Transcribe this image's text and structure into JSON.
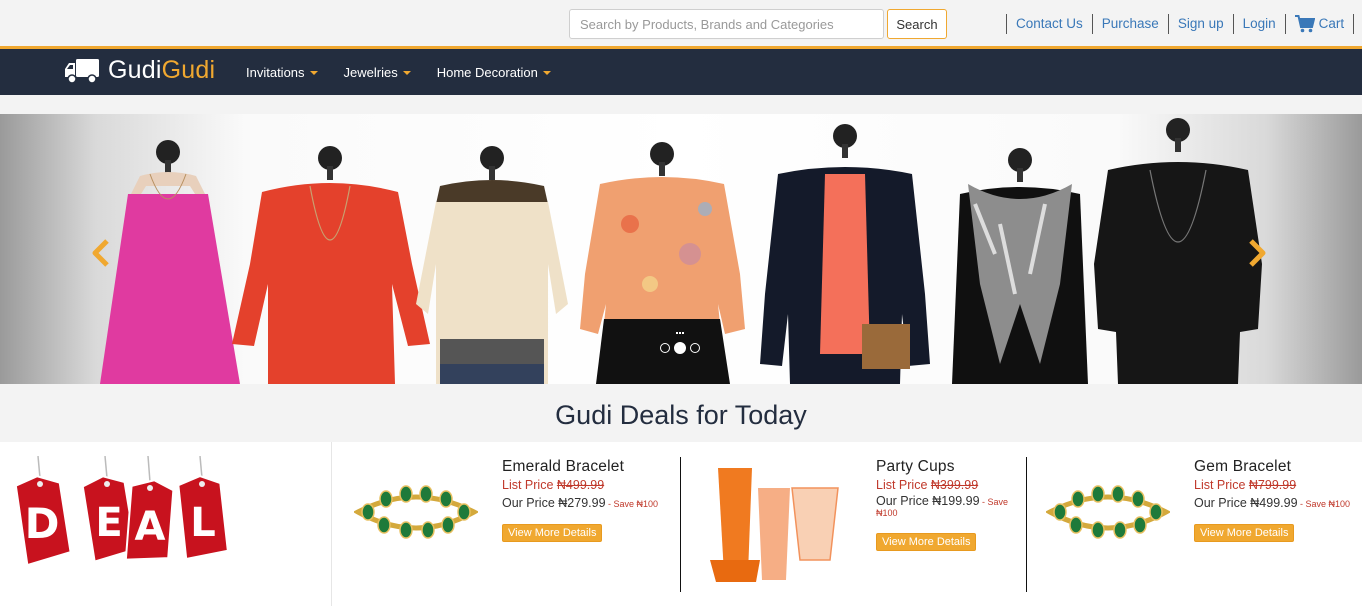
{
  "search": {
    "placeholder": "Search by Products, Brands and Categories",
    "value": "",
    "button_label": "Search"
  },
  "top_links": [
    {
      "label": "Contact Us"
    },
    {
      "label": "Purchase"
    },
    {
      "label": "Sign up"
    },
    {
      "label": "Login"
    },
    {
      "label": "Cart",
      "icon": "cart-icon"
    }
  ],
  "logo": {
    "part1": "Gudi",
    "part2": "Gudi",
    "icon": "truck-icon"
  },
  "nav": [
    {
      "label": "Invitations"
    },
    {
      "label": "Jewelries"
    },
    {
      "label": "Home Decoration"
    }
  ],
  "carousel": {
    "slides": 3,
    "active_slide": 2,
    "prev_icon": "chevron-left-icon",
    "next_icon": "chevron-right-icon"
  },
  "deals": {
    "title": "Gudi Deals for Today",
    "sign_letters": [
      "D",
      "E",
      "A",
      "L"
    ],
    "products": [
      {
        "name": "Emerald Bracelet",
        "list_label": "List Price ",
        "list_price": "₦499.99",
        "our_label": "Our Price ",
        "our_price": "₦279.99",
        "save": " - Save ₦100",
        "button": "View More Details"
      },
      {
        "name": "Party Cups",
        "list_label": "List Price ",
        "list_price": "₦399.99",
        "our_label": "Our Price ",
        "our_price": "₦199.99",
        "save": " - Save ₦100",
        "button": "View More Details"
      },
      {
        "name": "Gem Bracelet",
        "list_label": "List Price ",
        "list_price": "₦799.99",
        "our_label": "Our Price ",
        "our_price": "₦499.99",
        "save": " - Save ₦100",
        "button": "View More Details"
      }
    ]
  },
  "colors": {
    "accent": "#f0a830",
    "nav_bg": "#232d3f",
    "link": "#3a78b8",
    "price_red": "#c0392b"
  }
}
